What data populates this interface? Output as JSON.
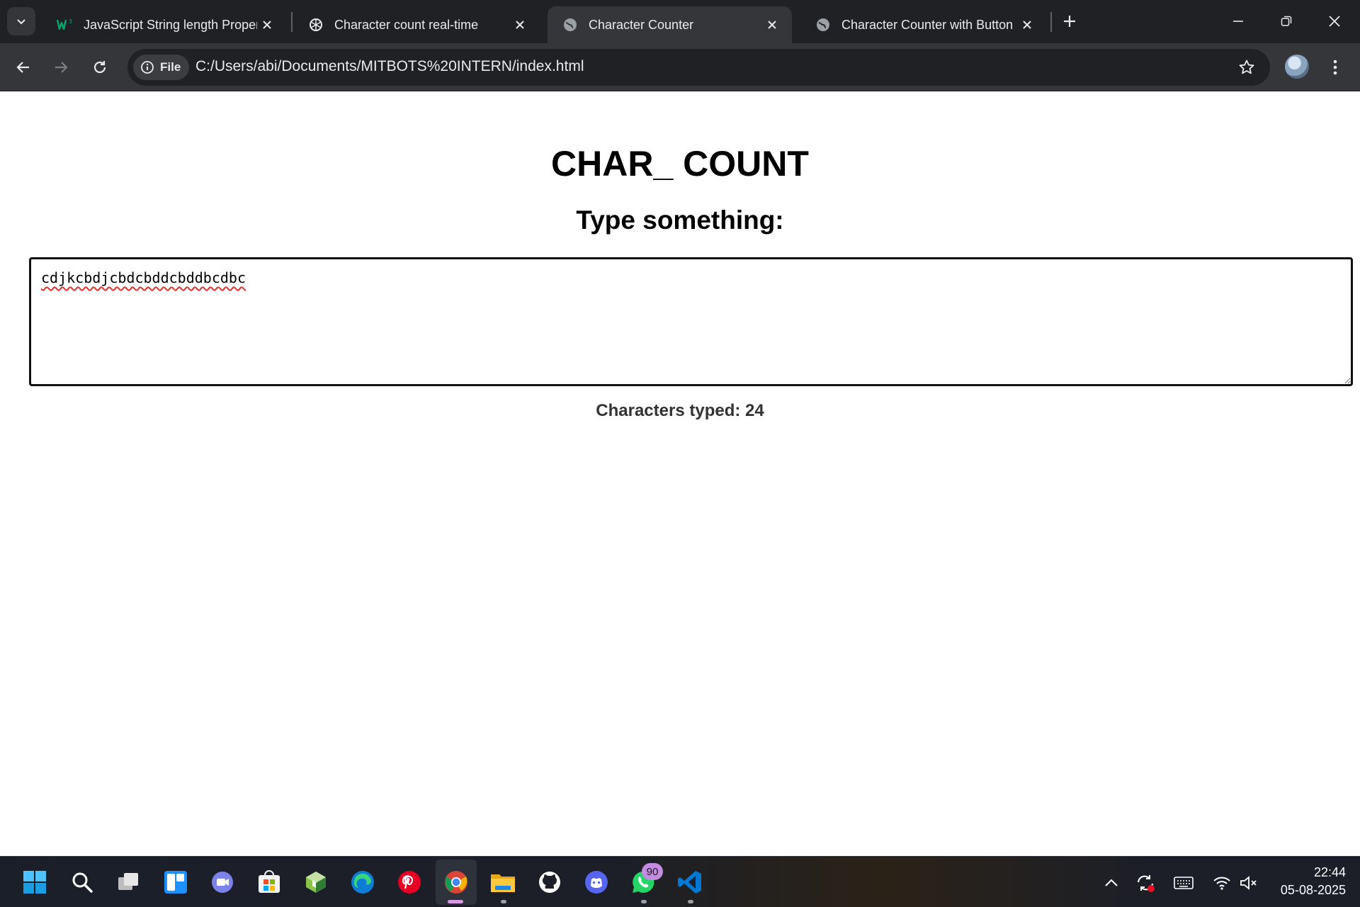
{
  "browser": {
    "tabs": [
      {
        "title": "JavaScript String length Propert",
        "icon": "w3schools-icon"
      },
      {
        "title": "Character count real-time",
        "icon": "chatgpt-icon"
      },
      {
        "title": "Character Counter",
        "icon": "globe-icon",
        "active": true
      },
      {
        "title": "Character Counter with Button",
        "icon": "globe-icon"
      }
    ],
    "chip_label": "File",
    "url": "C:/Users/abi/Documents/MITBOTS%20INTERN/index.html"
  },
  "page": {
    "title": "CHAR_ COUNT",
    "subtitle": "Type something:",
    "textarea_value": "cdjkcbdjcbdcbddcbddbcdbc",
    "count_text": "Characters typed: 24"
  },
  "taskbar": {
    "apps": [
      "start",
      "search",
      "task-view",
      "widgets",
      "teams",
      "store",
      "box-app",
      "edge",
      "pinterest",
      "chrome",
      "file-explorer",
      "github",
      "discord",
      "whatsapp",
      "vscode"
    ],
    "whatsapp_badge": "90",
    "time": "22:44",
    "date": "05-08-2025"
  },
  "colors": {
    "titlebar": "#202124",
    "toolbar": "#35363a",
    "page_background": "#ffffff"
  }
}
